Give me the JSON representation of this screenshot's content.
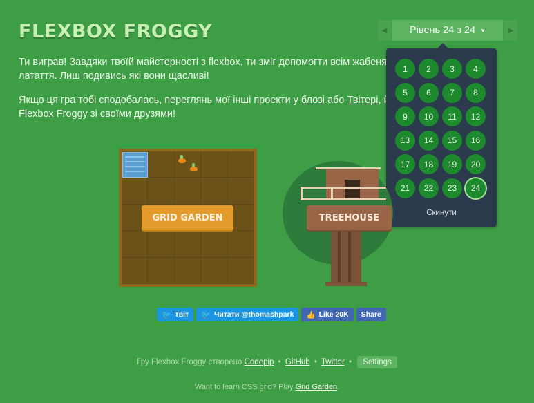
{
  "logo": "FLEXBOX FROGGY",
  "intro": {
    "line1": "Ти виграв! Завдяки твоїй майстерності з flexbox, ти зміг допомогти всім жабенятам дістатися своїх латаття. Лиш подивись які вони щасливі!",
    "line2_prefix": "Якщо ця гра тобі сподобалась, переглянь мої інші проекти у ",
    "blog_link": "блозі",
    "line2_mid": " або ",
    "twitter_link": "Твітері",
    "line2_suffix": ", й не забудь поділитися Flexbox Froggy зі своїми друзями!"
  },
  "level_selector": {
    "label": "Рівень 24 з 24",
    "levels": [
      "1",
      "2",
      "3",
      "4",
      "5",
      "6",
      "7",
      "8",
      "9",
      "10",
      "11",
      "12",
      "13",
      "14",
      "15",
      "16",
      "17",
      "18",
      "19",
      "20",
      "21",
      "22",
      "23",
      "24"
    ],
    "current": "24",
    "reset_label": "Скинути"
  },
  "projects": {
    "grid_garden": "GRID GARDEN",
    "treehouse": "TREEHOUSE"
  },
  "social": {
    "tweet": "Твіт",
    "follow": "Читати @thomashpark",
    "like": "Like 20K",
    "share": "Share"
  },
  "footer": {
    "prefix": "Гру Flexbox Froggy створено",
    "codepip": "Codepip",
    "github": "GitHub",
    "twitter": "Twitter",
    "settings": "Settings",
    "learn_prefix": "Want to learn CSS grid? Play",
    "grid_garden_link": "Grid Garden",
    "learn_suffix": "."
  },
  "colors": {
    "background": "#3e9e46",
    "dropdown": "#2b3a4c",
    "level_button": "#1e8a2e",
    "grid_garden": "#e59b2b",
    "treehouse": "#9a6547"
  }
}
